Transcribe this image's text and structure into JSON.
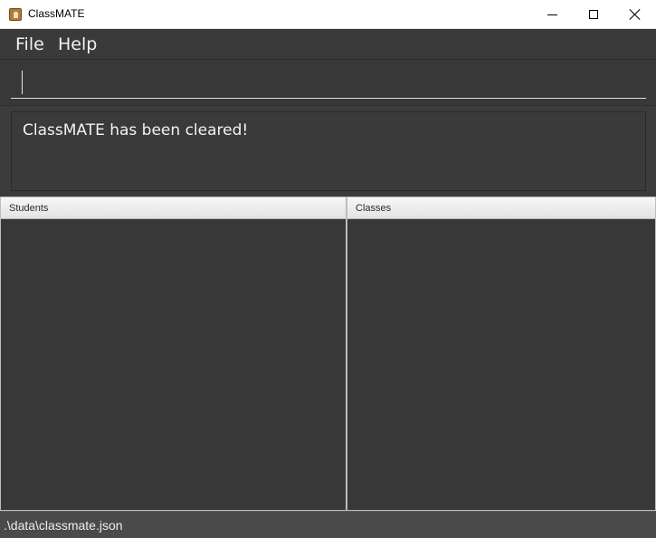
{
  "window": {
    "title": "ClassMATE",
    "icon": "app-icon"
  },
  "menu": {
    "items": [
      {
        "label": "File"
      },
      {
        "label": "Help"
      }
    ]
  },
  "command": {
    "value": "",
    "placeholder": ""
  },
  "result": {
    "message": "ClassMATE has been cleared!"
  },
  "lists": {
    "students": {
      "header": "Students",
      "items": []
    },
    "classes": {
      "header": "Classes",
      "items": []
    }
  },
  "status": {
    "path": ".\\data\\classmate.json"
  },
  "colors": {
    "background": "#3c3c3c",
    "panel": "#383838",
    "status_bar": "#4a4a4a",
    "text": "#f2f2f2"
  }
}
